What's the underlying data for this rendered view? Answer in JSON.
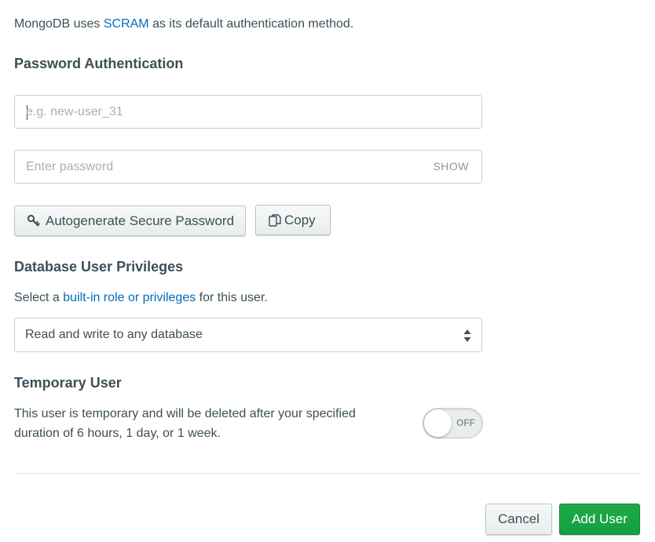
{
  "intro": {
    "prefix": "MongoDB uses ",
    "link": "SCRAM",
    "suffix": " as its default authentication method."
  },
  "password_auth": {
    "title": "Password Authentication",
    "username_placeholder": "e.g. new-user_31",
    "username_value": "",
    "password_placeholder": "Enter password",
    "password_value": "",
    "show_label": "SHOW",
    "autogenerate_label": "Autogenerate Secure Password",
    "autogenerate_icon": "key-icon",
    "copy_label": "Copy",
    "copy_icon": "copy-icon"
  },
  "privileges": {
    "title": "Database User Privileges",
    "desc_prefix": "Select a ",
    "desc_link": "built-in role or privileges",
    "desc_suffix": " for this user.",
    "selected": "Read and write to any database"
  },
  "temporary": {
    "title": "Temporary User",
    "desc_line1": "This user is temporary and will be deleted after your specified",
    "desc_line2": "duration of 6 hours, 1 day, or 1 week.",
    "toggle_state": "OFF"
  },
  "footer": {
    "cancel_label": "Cancel",
    "add_label": "Add User"
  },
  "colors": {
    "link": "#006cbc",
    "primary": "#13a040",
    "text": "#3d4f58"
  }
}
